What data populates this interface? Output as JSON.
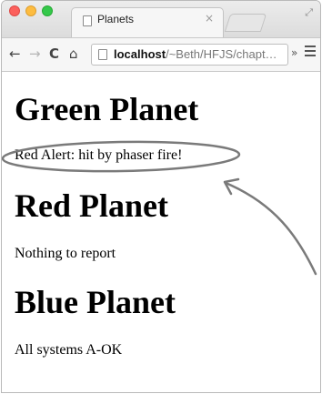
{
  "browser": {
    "tab_title": "Planets",
    "tab_close": "×",
    "address": {
      "host": "localhost",
      "path": "/~Beth/HFJS/chapt…"
    },
    "overflow_label": "»"
  },
  "page": {
    "sections": [
      {
        "heading": "Green Planet",
        "text": "Red Alert: hit by phaser fire!"
      },
      {
        "heading": "Red Planet",
        "text": "Nothing to report"
      },
      {
        "heading": "Blue Planet",
        "text": "All systems A-OK"
      }
    ]
  },
  "icons": [
    "window-close-icon",
    "window-minimize-icon",
    "window-maximize-icon",
    "tab-page-icon",
    "back-arrow-icon",
    "forward-arrow-icon",
    "reload-icon",
    "home-icon",
    "page-icon",
    "menu-icon",
    "fullscreen-icon"
  ]
}
